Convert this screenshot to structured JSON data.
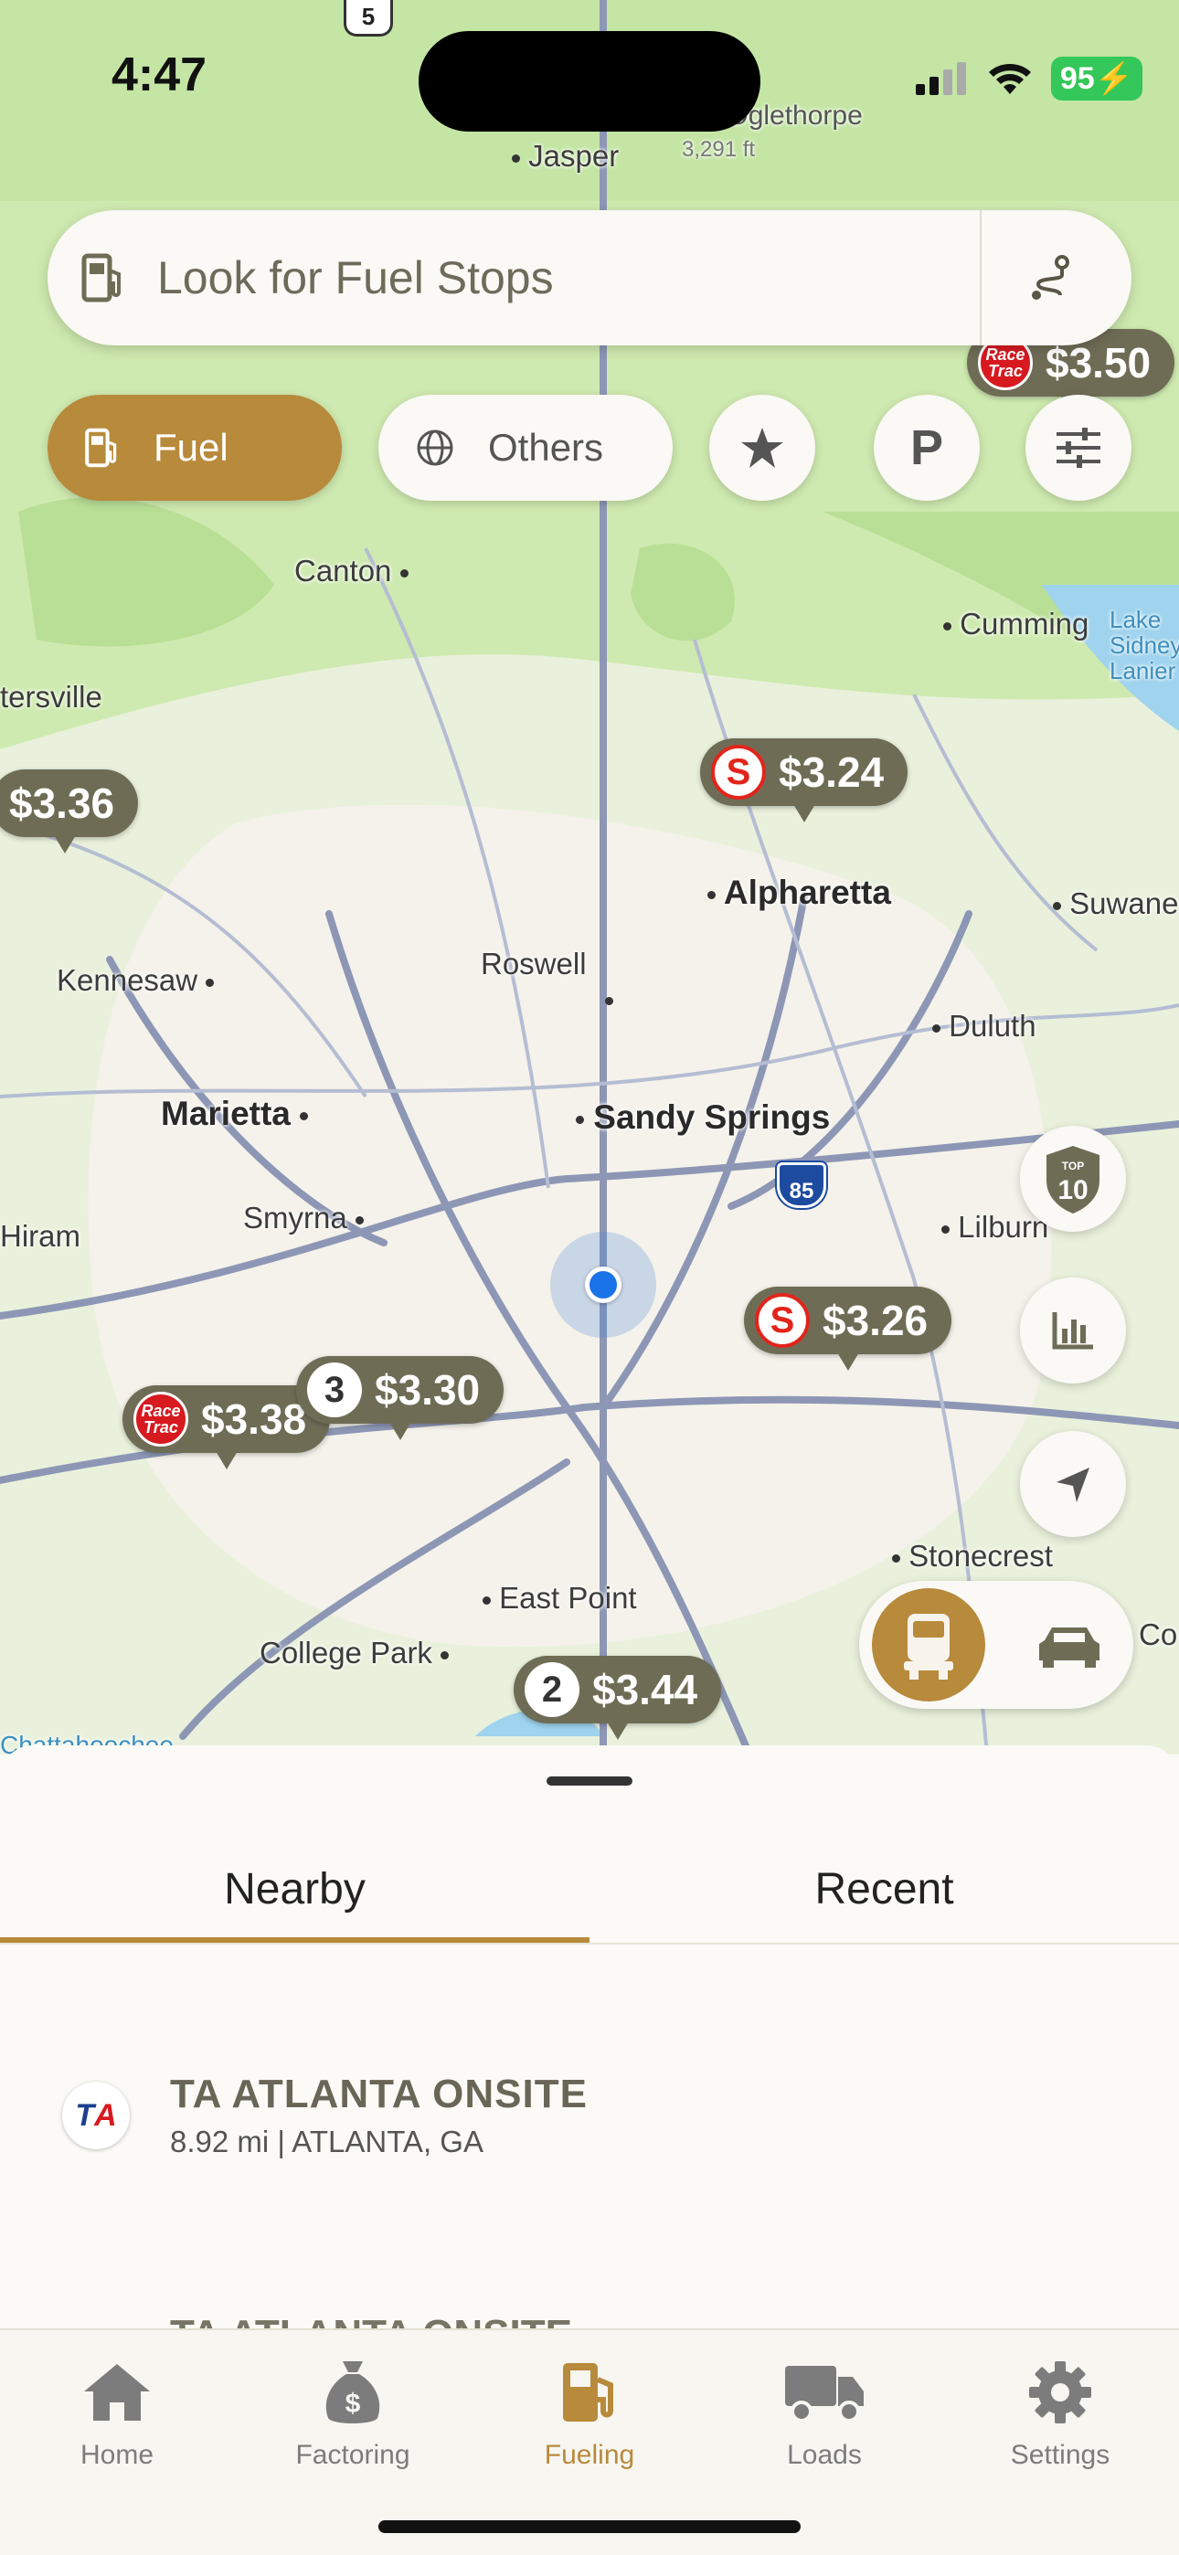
{
  "status_bar": {
    "time": "4:47",
    "battery": "95"
  },
  "map": {
    "route_shield": "5",
    "cities": [
      {
        "name": "Jasper"
      },
      {
        "name": "nt Oglethorpe"
      },
      {
        "name": "3,291 ft"
      },
      {
        "name": "Canton"
      },
      {
        "name": "Cumming"
      },
      {
        "name": "Lake Sidney Lanier"
      },
      {
        "name": "tersville"
      },
      {
        "name": "Alpharetta"
      },
      {
        "name": "Suwane"
      },
      {
        "name": "Kennesaw"
      },
      {
        "name": "Roswell"
      },
      {
        "name": "Duluth"
      },
      {
        "name": "Marietta"
      },
      {
        "name": "Sandy Springs"
      },
      {
        "name": "Smyrna"
      },
      {
        "name": "Lilburn"
      },
      {
        "name": "Hiram"
      },
      {
        "name": "Stonecrest"
      },
      {
        "name": "East Point"
      },
      {
        "name": "College Park"
      },
      {
        "name": "Co"
      },
      {
        "name": "Chattahoochee"
      }
    ],
    "interstate_label": "85",
    "price_pins": [
      {
        "price": "$3.50",
        "brand": "racetrac"
      },
      {
        "price": "$3.24",
        "brand": "speedway"
      },
      {
        "price": "$3.36",
        "brand": "none"
      },
      {
        "price": "$3.26",
        "brand": "speedway"
      },
      {
        "price": "$3.30",
        "brand": "count",
        "count": "3"
      },
      {
        "price": "$3.38",
        "brand": "racetrac"
      },
      {
        "price": "$3.44",
        "brand": "count",
        "count": "2"
      }
    ],
    "racetrac_logo_text": "Race Trac",
    "speedway_logo_text": "S",
    "top10_badge": "TOP 10"
  },
  "search": {
    "placeholder": "Look for Fuel Stops"
  },
  "filters": {
    "fuel_label": "Fuel",
    "others_label": "Others",
    "parking_label": "P"
  },
  "sheet": {
    "tabs": [
      {
        "label": "Nearby"
      },
      {
        "label": "Recent"
      }
    ],
    "items": [
      {
        "name": "TA ATLANTA ONSITE",
        "detail": "8.92 mi | ATLANTA, GA",
        "logo": "TA"
      },
      {
        "name": "TA ATLANTA ONSITE"
      }
    ]
  },
  "tabbar": [
    {
      "label": "Home",
      "icon": "home-icon"
    },
    {
      "label": "Factoring",
      "icon": "money-bag-icon"
    },
    {
      "label": "Fueling",
      "icon": "fuel-pump-icon"
    },
    {
      "label": "Loads",
      "icon": "truck-icon"
    },
    {
      "label": "Settings",
      "icon": "gear-icon"
    }
  ],
  "colors": {
    "accent": "#b88a3c",
    "pin": "#6f6c56",
    "map": "#cfeab0"
  }
}
